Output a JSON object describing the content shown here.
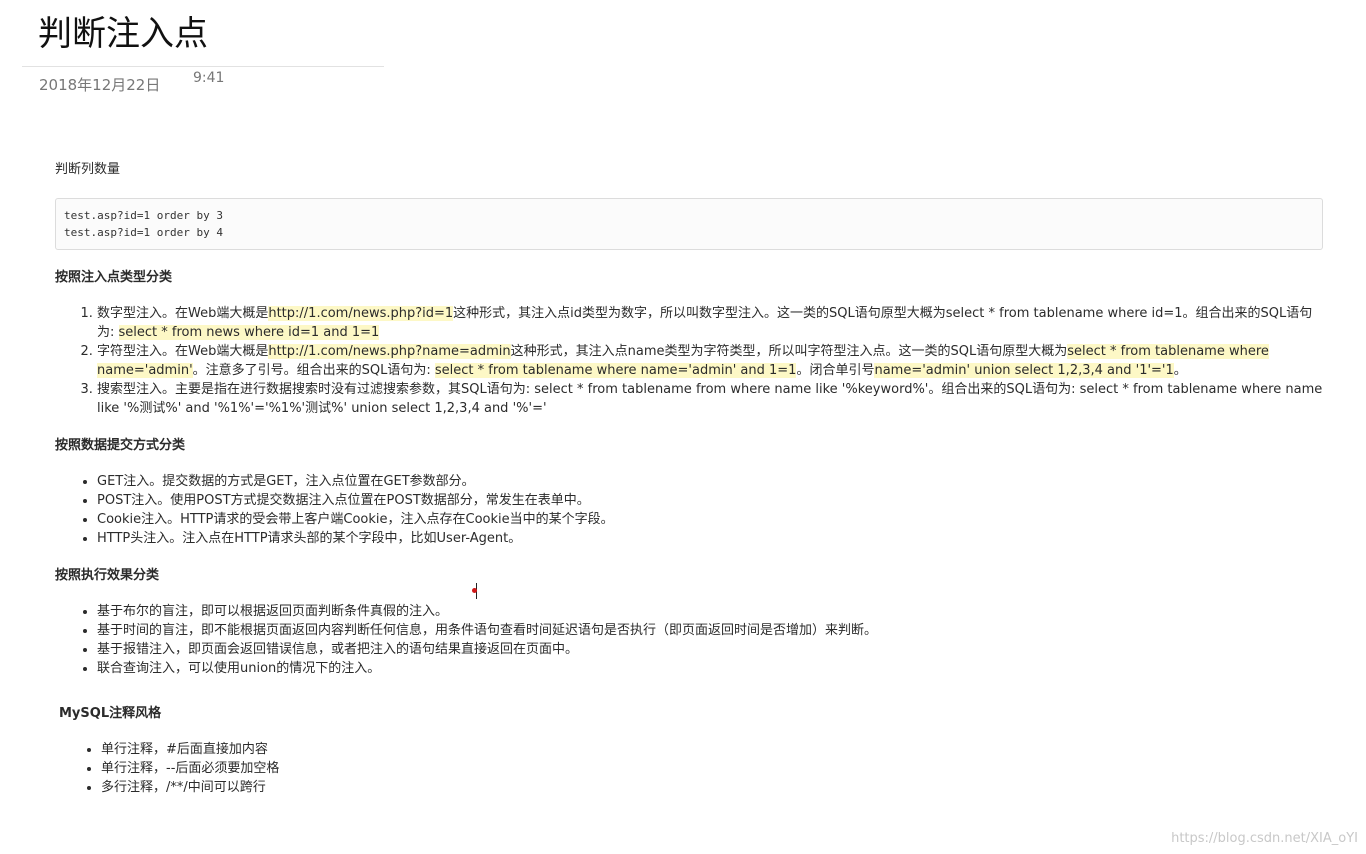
{
  "header": {
    "title": "判断注入点",
    "date": "2018年12月22日",
    "time": "9:41"
  },
  "intro": {
    "label": "判断列数量",
    "code": [
      "test.asp?id=1 order by 3",
      "test.asp?id=1 order by 4"
    ]
  },
  "section_type": {
    "heading": "按照注入点类型分类",
    "items": [
      {
        "parts": [
          {
            "text": "数字型注入。在Web端大概是",
            "hl": false
          },
          {
            "text": "http://1.com/news.php?id=1",
            "hl": true
          },
          {
            "text": "这种形式，其注入点id类型为数字，所以叫数字型注入。这一类的SQL语句原型大概为select * from tablename where id=1。组合出来的SQL语句为: ",
            "hl": false
          },
          {
            "text": "select * from news where id=1 and 1=1",
            "hl": true
          }
        ]
      },
      {
        "parts": [
          {
            "text": "字符型注入。在Web端大概是",
            "hl": false
          },
          {
            "text": "http://1.com/news.php?name=admin",
            "hl": true
          },
          {
            "text": "这种形式，其注入点name类型为字符类型，所以叫字符型注入点。这一类的SQL语句原型大概为",
            "hl": false
          },
          {
            "text": "select * from tablename where name='admin'",
            "hl": true
          },
          {
            "text": "。注意多了引号。组合出来的SQL语句为: ",
            "hl": false
          },
          {
            "text": "select * from tablename where name='admin' and 1=1",
            "hl": true
          },
          {
            "text": "。闭合单引号",
            "hl": false
          },
          {
            "text": "name='admin' union select 1,2,3,4 and '1'='1",
            "hl": true
          },
          {
            "text": "。",
            "hl": false
          }
        ]
      },
      {
        "parts": [
          {
            "text": "搜索型注入。主要是指在进行数据搜索时没有过滤搜索参数，其SQL语句为: select * from tablename from where name like '%keyword%'。组合出来的SQL语句为: select * from tablename where name like '%测试%' and '%1%'='%1%'测试%' union select 1,2,3,4 and '%'='",
            "hl": false
          }
        ]
      }
    ]
  },
  "section_submit": {
    "heading": "按照数据提交方式分类",
    "items": [
      "GET注入。提交数据的方式是GET，注入点位置在GET参数部分。",
      "POST注入。使用POST方式提交数据注入点位置在POST数据部分，常发生在表单中。",
      "Cookie注入。HTTP请求的受会带上客户端Cookie，注入点存在Cookie当中的某个字段。",
      "HTTP头注入。注入点在HTTP请求头部的某个字段中，比如User-Agent。"
    ]
  },
  "section_effect": {
    "heading": "按照执行效果分类",
    "items": [
      "基于布尔的盲注，即可以根据返回页面判断条件真假的注入。",
      "基于时间的盲注，即不能根据页面返回内容判断任何信息，用条件语句查看时间延迟语句是否执行（即页面返回时间是否增加）来判断。",
      "基于报错注入，即页面会返回错误信息，或者把注入的语句结果直接返回在页面中。",
      "联合查询注入，可以使用union的情况下的注入。"
    ]
  },
  "section_comment": {
    "heading": "MySQL注释风格",
    "items": [
      "单行注释，#后面直接加内容",
      "单行注释，--后面必须要加空格",
      "多行注释，/**/中间可以跨行"
    ]
  },
  "watermark": "https://blog.csdn.net/XIA_oYI"
}
